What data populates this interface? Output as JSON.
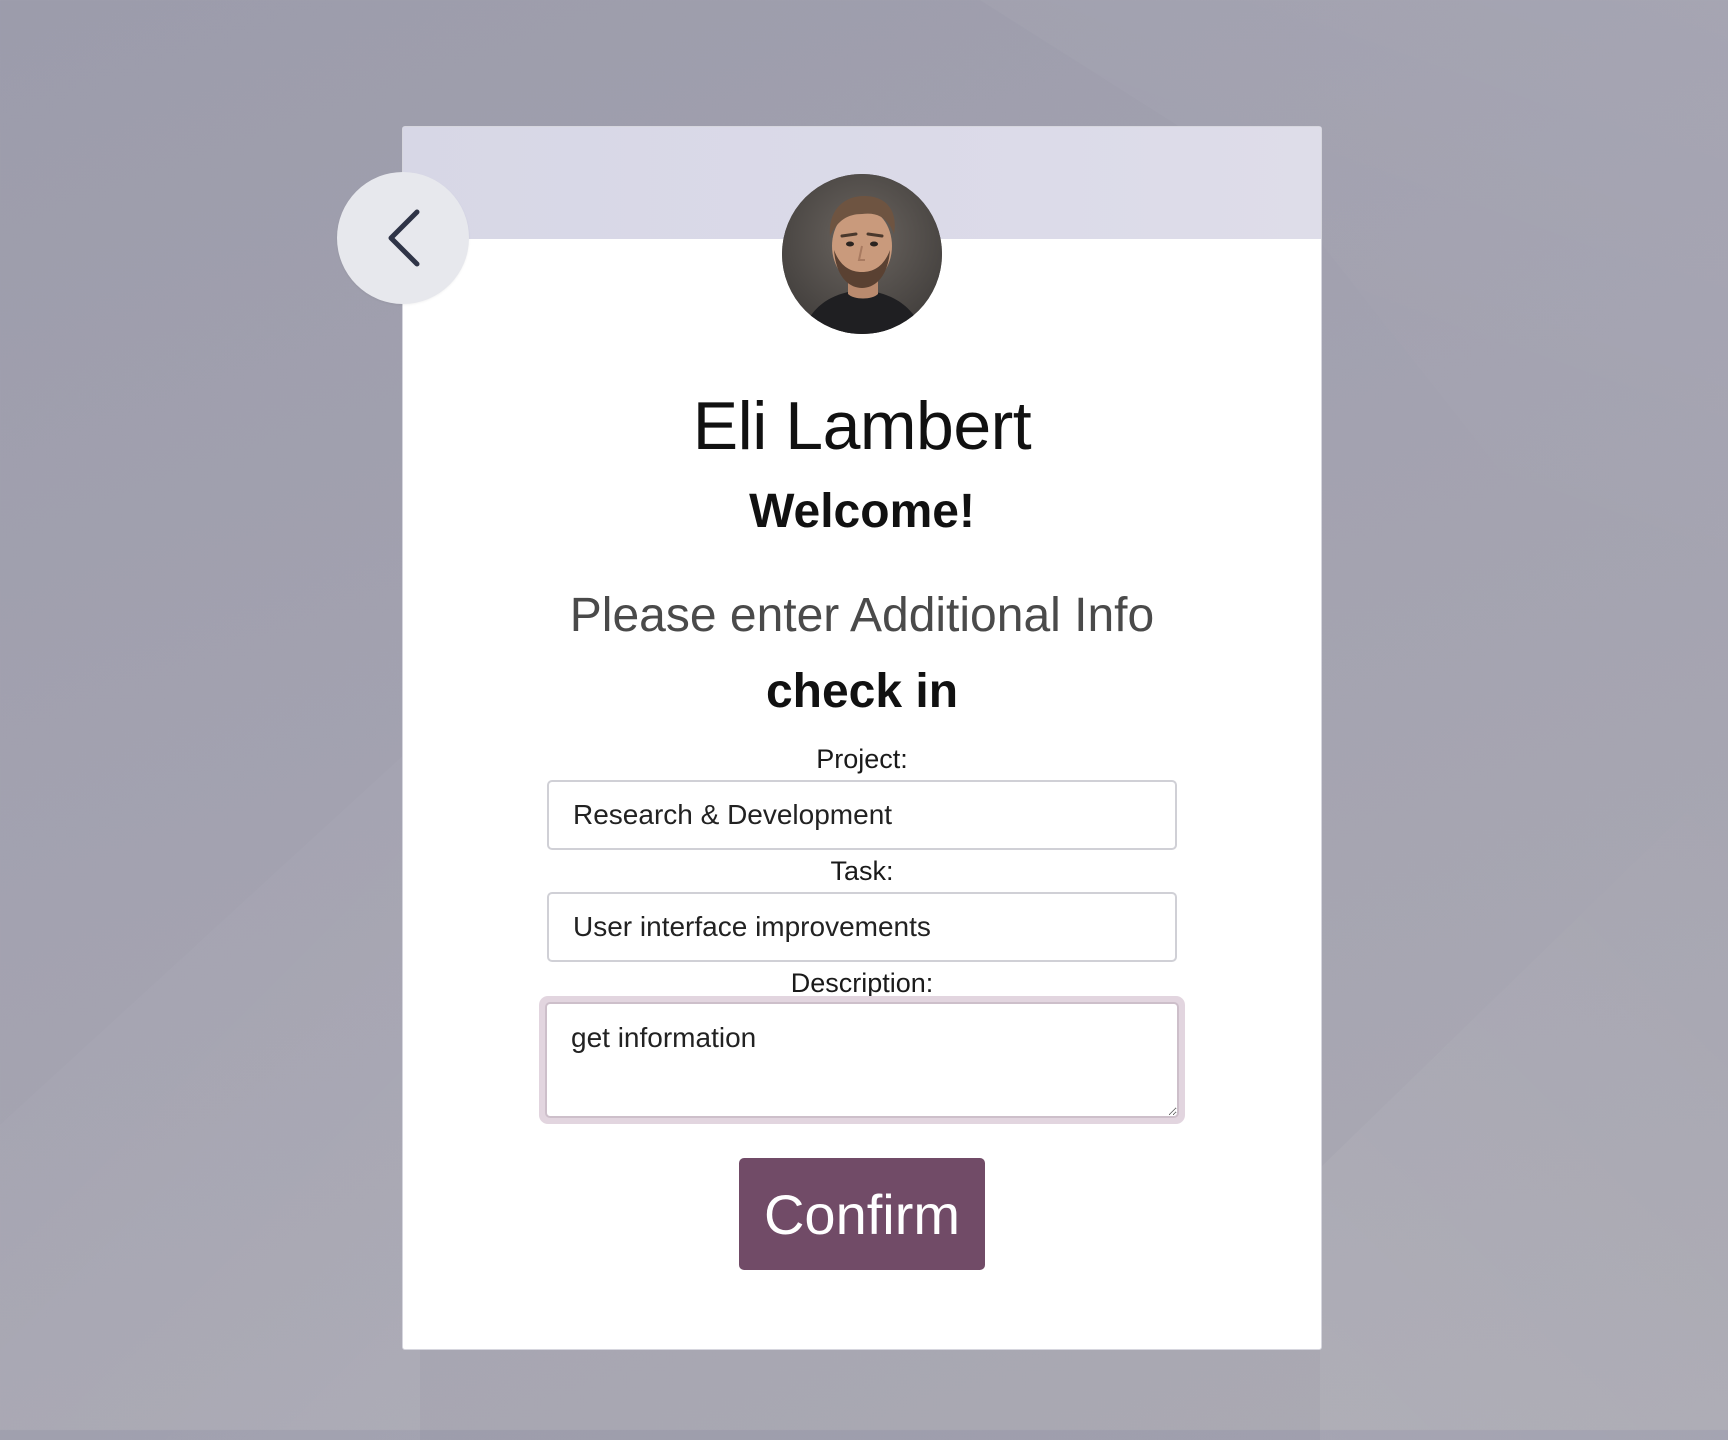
{
  "employee": {
    "name": "Eli Lambert",
    "greeting": "Welcome!"
  },
  "form": {
    "instruction": "Please enter Additional Info",
    "action": "check in",
    "project_label": "Project:",
    "project_value": "Research & Development",
    "task_label": "Task:",
    "task_value": "User interface improvements",
    "description_label": "Description:",
    "description_value": "get information",
    "confirm_label": "Confirm"
  },
  "icons": {
    "back": "chevron-left-icon",
    "avatar": "avatar-photo"
  },
  "colors": {
    "primary": "#714b67",
    "header_band": "#d7d7e6",
    "background": "#a3a2b0",
    "focus_ring": "#e2d5df"
  }
}
